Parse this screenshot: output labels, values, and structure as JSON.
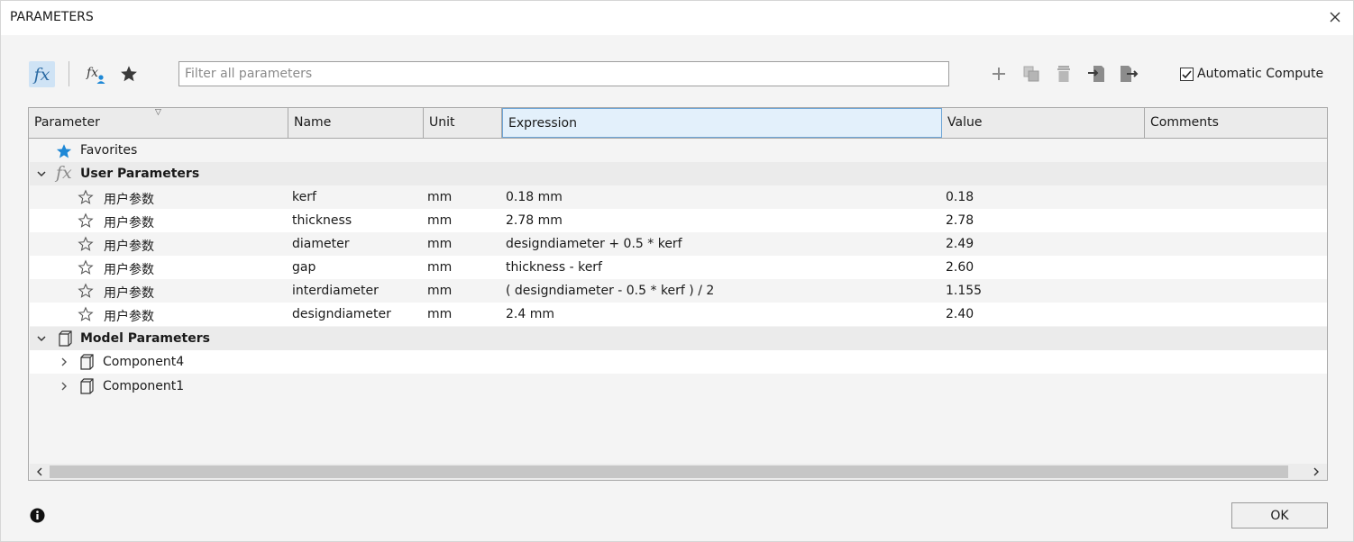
{
  "window": {
    "title": "PARAMETERS"
  },
  "toolbar": {
    "filter_placeholder": "Filter all parameters",
    "fx_icon": "fx",
    "automatic_compute_label": "Automatic Compute",
    "automatic_compute_checked": true
  },
  "table": {
    "columns": [
      "Parameter",
      "Name",
      "Unit",
      "Expression",
      "Value",
      "Comments"
    ],
    "favorites_label": "Favorites",
    "user_group_label": "User Parameters",
    "user_rows": [
      {
        "parameter": "用户参数",
        "name": "kerf",
        "unit": "mm",
        "expression": "0.18 mm",
        "value": "0.18",
        "comments": ""
      },
      {
        "parameter": "用户参数",
        "name": "thickness",
        "unit": "mm",
        "expression": "2.78 mm",
        "value": "2.78",
        "comments": ""
      },
      {
        "parameter": "用户参数",
        "name": "diameter",
        "unit": "mm",
        "expression": "designdiameter + 0.5 * kerf",
        "value": "2.49",
        "comments": ""
      },
      {
        "parameter": "用户参数",
        "name": "gap",
        "unit": "mm",
        "expression": "thickness - kerf",
        "value": "2.60",
        "comments": ""
      },
      {
        "parameter": "用户参数",
        "name": "interdiameter",
        "unit": "mm",
        "expression": "( designdiameter - 0.5 * kerf ) / 2",
        "value": "1.155",
        "comments": ""
      },
      {
        "parameter": "用户参数",
        "name": "designdiameter",
        "unit": "mm",
        "expression": "2.4 mm",
        "value": "2.40",
        "comments": ""
      }
    ],
    "model_group_label": "Model Parameters",
    "components": [
      "Component4",
      "Component1"
    ]
  },
  "footer": {
    "ok_label": "OK"
  },
  "colors": {
    "accent": "#1e88d6",
    "selected_header": "#e3f0fb"
  }
}
